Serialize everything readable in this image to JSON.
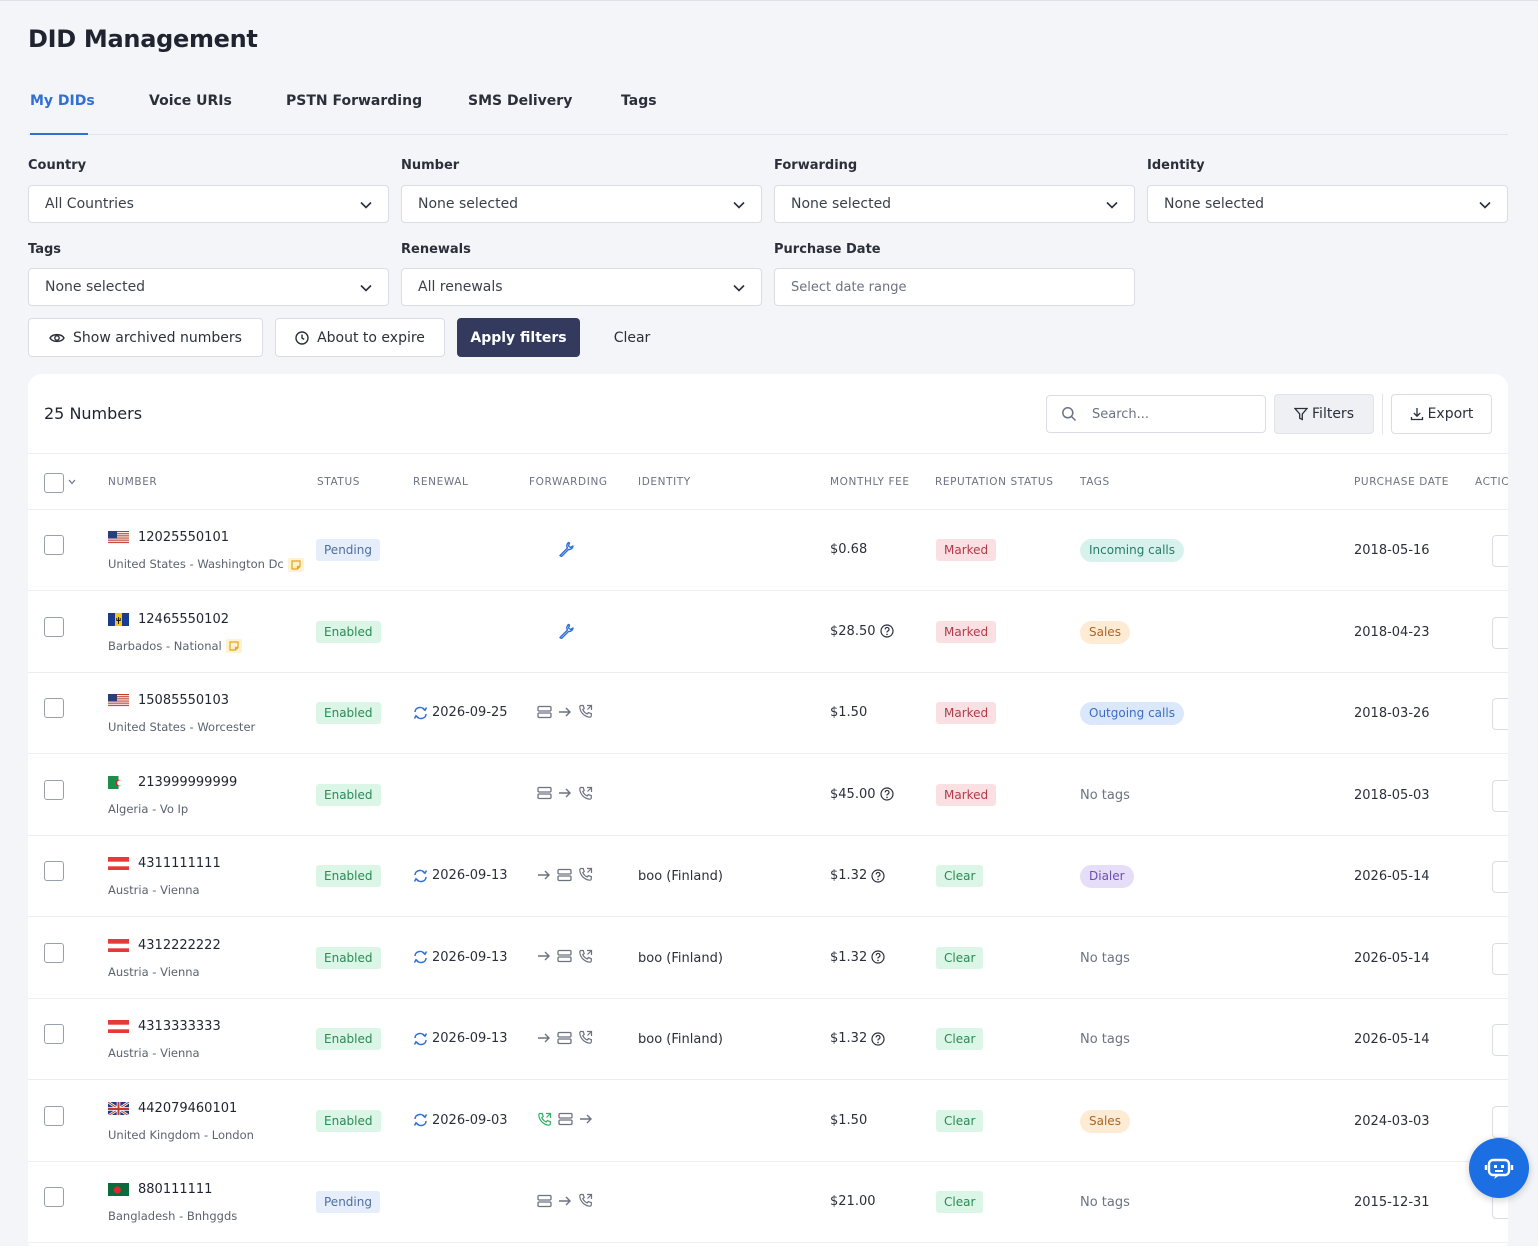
{
  "page": {
    "title": "DID Management"
  },
  "tabs": [
    {
      "label": "My DIDs",
      "active": true
    },
    {
      "label": "Voice URIs"
    },
    {
      "label": "PSTN Forwarding"
    },
    {
      "label": "SMS Delivery"
    },
    {
      "label": "Tags"
    }
  ],
  "filters": {
    "country": {
      "label": "Country",
      "value": "All Countries"
    },
    "number": {
      "label": "Number",
      "value": "None selected"
    },
    "forwarding": {
      "label": "Forwarding",
      "value": "None selected"
    },
    "identity": {
      "label": "Identity",
      "value": "None selected"
    },
    "tags": {
      "label": "Tags",
      "value": "None selected"
    },
    "renewals": {
      "label": "Renewals",
      "value": "All renewals"
    },
    "purchase_date": {
      "label": "Purchase Date",
      "placeholder": "Select date range"
    }
  },
  "actions": {
    "show_archived": "Show archived numbers",
    "about_to_expire": "About to expire",
    "apply": "Apply filters",
    "clear": "Clear"
  },
  "table": {
    "count_label": "25 Numbers",
    "search_placeholder": "Search...",
    "filters_btn": "Filters",
    "export_btn": "Export",
    "columns": {
      "number": "NUMBER",
      "status": "STATUS",
      "renewal": "RENEWAL",
      "forwarding": "FORWARDING",
      "identity": "IDENTITY",
      "monthly_fee": "MONTHLY FEE",
      "reputation": "REPUTATION STATUS",
      "tags": "TAGS",
      "purchase_date": "PURCHASE DATE",
      "actions": "ACTIC"
    },
    "rows": [
      {
        "number": "12025550101",
        "location": "United States - Washington Dc",
        "flag": "us",
        "note": true,
        "status": "Pending",
        "renewal": "",
        "forwarding": "wrench",
        "identity": "",
        "fee": "$0.68",
        "fee_help": false,
        "reputation": "Marked",
        "tag": "Incoming calls",
        "tag_style": "incoming",
        "purchase": "2018-05-16"
      },
      {
        "number": "12465550102",
        "location": "Barbados - National",
        "flag": "bb",
        "note": true,
        "status": "Enabled",
        "renewal": "",
        "forwarding": "wrench",
        "identity": "",
        "fee": "$28.50",
        "fee_help": true,
        "reputation": "Marked",
        "tag": "Sales",
        "tag_style": "sales",
        "purchase": "2018-04-23"
      },
      {
        "number": "15085550103",
        "location": "United States - Worcester",
        "flag": "us",
        "note": false,
        "status": "Enabled",
        "renewal": "2026-09-25",
        "forwarding": "server-arrow-phone",
        "identity": "",
        "fee": "$1.50",
        "fee_help": false,
        "reputation": "Marked",
        "tag": "Outgoing calls",
        "tag_style": "outgoing",
        "purchase": "2018-03-26"
      },
      {
        "number": "213999999999",
        "location": "Algeria - Vo Ip",
        "flag": "dz",
        "note": false,
        "status": "Enabled",
        "renewal": "",
        "forwarding": "server-arrow-phone",
        "identity": "",
        "fee": "$45.00",
        "fee_help": true,
        "reputation": "Marked",
        "tag": "No tags",
        "tag_style": "none",
        "purchase": "2018-05-03"
      },
      {
        "number": "4311111111",
        "location": "Austria - Vienna",
        "flag": "at",
        "note": false,
        "status": "Enabled",
        "renewal": "2026-09-13",
        "forwarding": "arrow-server-phone",
        "identity": "boo (Finland)",
        "fee": "$1.32",
        "fee_help": true,
        "reputation": "Clear",
        "tag": "Dialer",
        "tag_style": "dialer",
        "purchase": "2026-05-14"
      },
      {
        "number": "4312222222",
        "location": "Austria - Vienna",
        "flag": "at",
        "note": false,
        "status": "Enabled",
        "renewal": "2026-09-13",
        "forwarding": "arrow-server-phone",
        "identity": "boo (Finland)",
        "fee": "$1.32",
        "fee_help": true,
        "reputation": "Clear",
        "tag": "No tags",
        "tag_style": "none",
        "purchase": "2026-05-14"
      },
      {
        "number": "4313333333",
        "location": "Austria - Vienna",
        "flag": "at",
        "note": false,
        "status": "Enabled",
        "renewal": "2026-09-13",
        "forwarding": "arrow-server-phone",
        "identity": "boo (Finland)",
        "fee": "$1.32",
        "fee_help": true,
        "reputation": "Clear",
        "tag": "No tags",
        "tag_style": "none",
        "purchase": "2026-05-14"
      },
      {
        "number": "442079460101",
        "location": "United Kingdom - London",
        "flag": "gb",
        "note": false,
        "status": "Enabled",
        "renewal": "2026-09-03",
        "forwarding": "phone-server-arrow",
        "identity": "",
        "fee": "$1.50",
        "fee_help": false,
        "reputation": "Clear",
        "tag": "Sales",
        "tag_style": "sales",
        "purchase": "2024-03-03"
      },
      {
        "number": "880111111",
        "location": "Bangladesh - Bnhggds",
        "flag": "bd",
        "note": false,
        "status": "Pending",
        "renewal": "",
        "forwarding": "server-arrow-phone",
        "identity": "",
        "fee": "$21.00",
        "fee_help": false,
        "reputation": "Clear",
        "tag": "No tags",
        "tag_style": "none",
        "purchase": "2015-12-31"
      }
    ]
  },
  "colors": {
    "accent": "#2f6fd6",
    "primary_button": "#343a5e",
    "help_button": "#1c6fe3"
  }
}
